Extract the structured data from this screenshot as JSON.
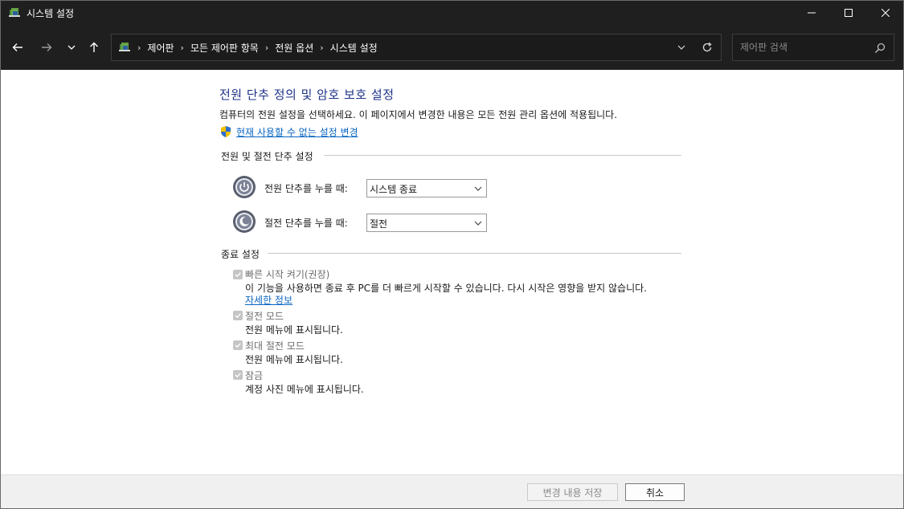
{
  "window": {
    "title": "시스템 설정",
    "controls": [
      "minimize",
      "maximize",
      "close"
    ]
  },
  "navigation": {
    "back_icon": "arrow-left-icon",
    "forward_icon": "arrow-right-icon",
    "recent_icon": "chevron-down-icon",
    "up_icon": "arrow-up-icon"
  },
  "address_bar": {
    "breadcrumbs": [
      "제어판",
      "모든 제어판 항목",
      "전원 옵션",
      "시스템 설정"
    ]
  },
  "search": {
    "placeholder": "제어판 검색"
  },
  "page": {
    "heading": "전원 단추 정의 및 암호 보호 설정",
    "description": "컴퓨터의 전원 설정을 선택하세요. 이 페이지에서 변경한 내용은 모든 전원 관리 옵션에 적용됩니다.",
    "admin_link": "현재 사용할 수 없는 설정 변경"
  },
  "power_section": {
    "title": "전원 및 절전 단추 설정",
    "rows": [
      {
        "label": "전원 단추를 누를 때:",
        "value": "시스템 종료",
        "icon": "power-button-icon"
      },
      {
        "label": "절전 단추를 누를 때:",
        "value": "절전",
        "icon": "sleep-button-icon"
      }
    ]
  },
  "shutdown_section": {
    "title": "종료 설정",
    "options": [
      {
        "label": "빠른 시작 켜기(권장)",
        "description": "이 기능을 사용하면 종료 후 PC를 더 빠르게 시작할 수 있습니다. 다시 시작은 영향을 받지 않습니다.",
        "link": "자세한 정보",
        "checked": true,
        "disabled": true
      },
      {
        "label": "절전 모드",
        "description": "전원 메뉴에 표시됩니다.",
        "checked": true,
        "disabled": true
      },
      {
        "label": "최대 절전 모드",
        "description": "전원 메뉴에 표시됩니다.",
        "checked": true,
        "disabled": true
      },
      {
        "label": "잠금",
        "description": "계정 사진 메뉴에 표시됩니다.",
        "checked": true,
        "disabled": true
      }
    ]
  },
  "footer": {
    "save_label": "변경 내용 저장",
    "cancel_label": "취소"
  },
  "colors": {
    "titlebar": "#1f1f1f",
    "heading": "#1e3287",
    "link": "#0a66c2"
  }
}
